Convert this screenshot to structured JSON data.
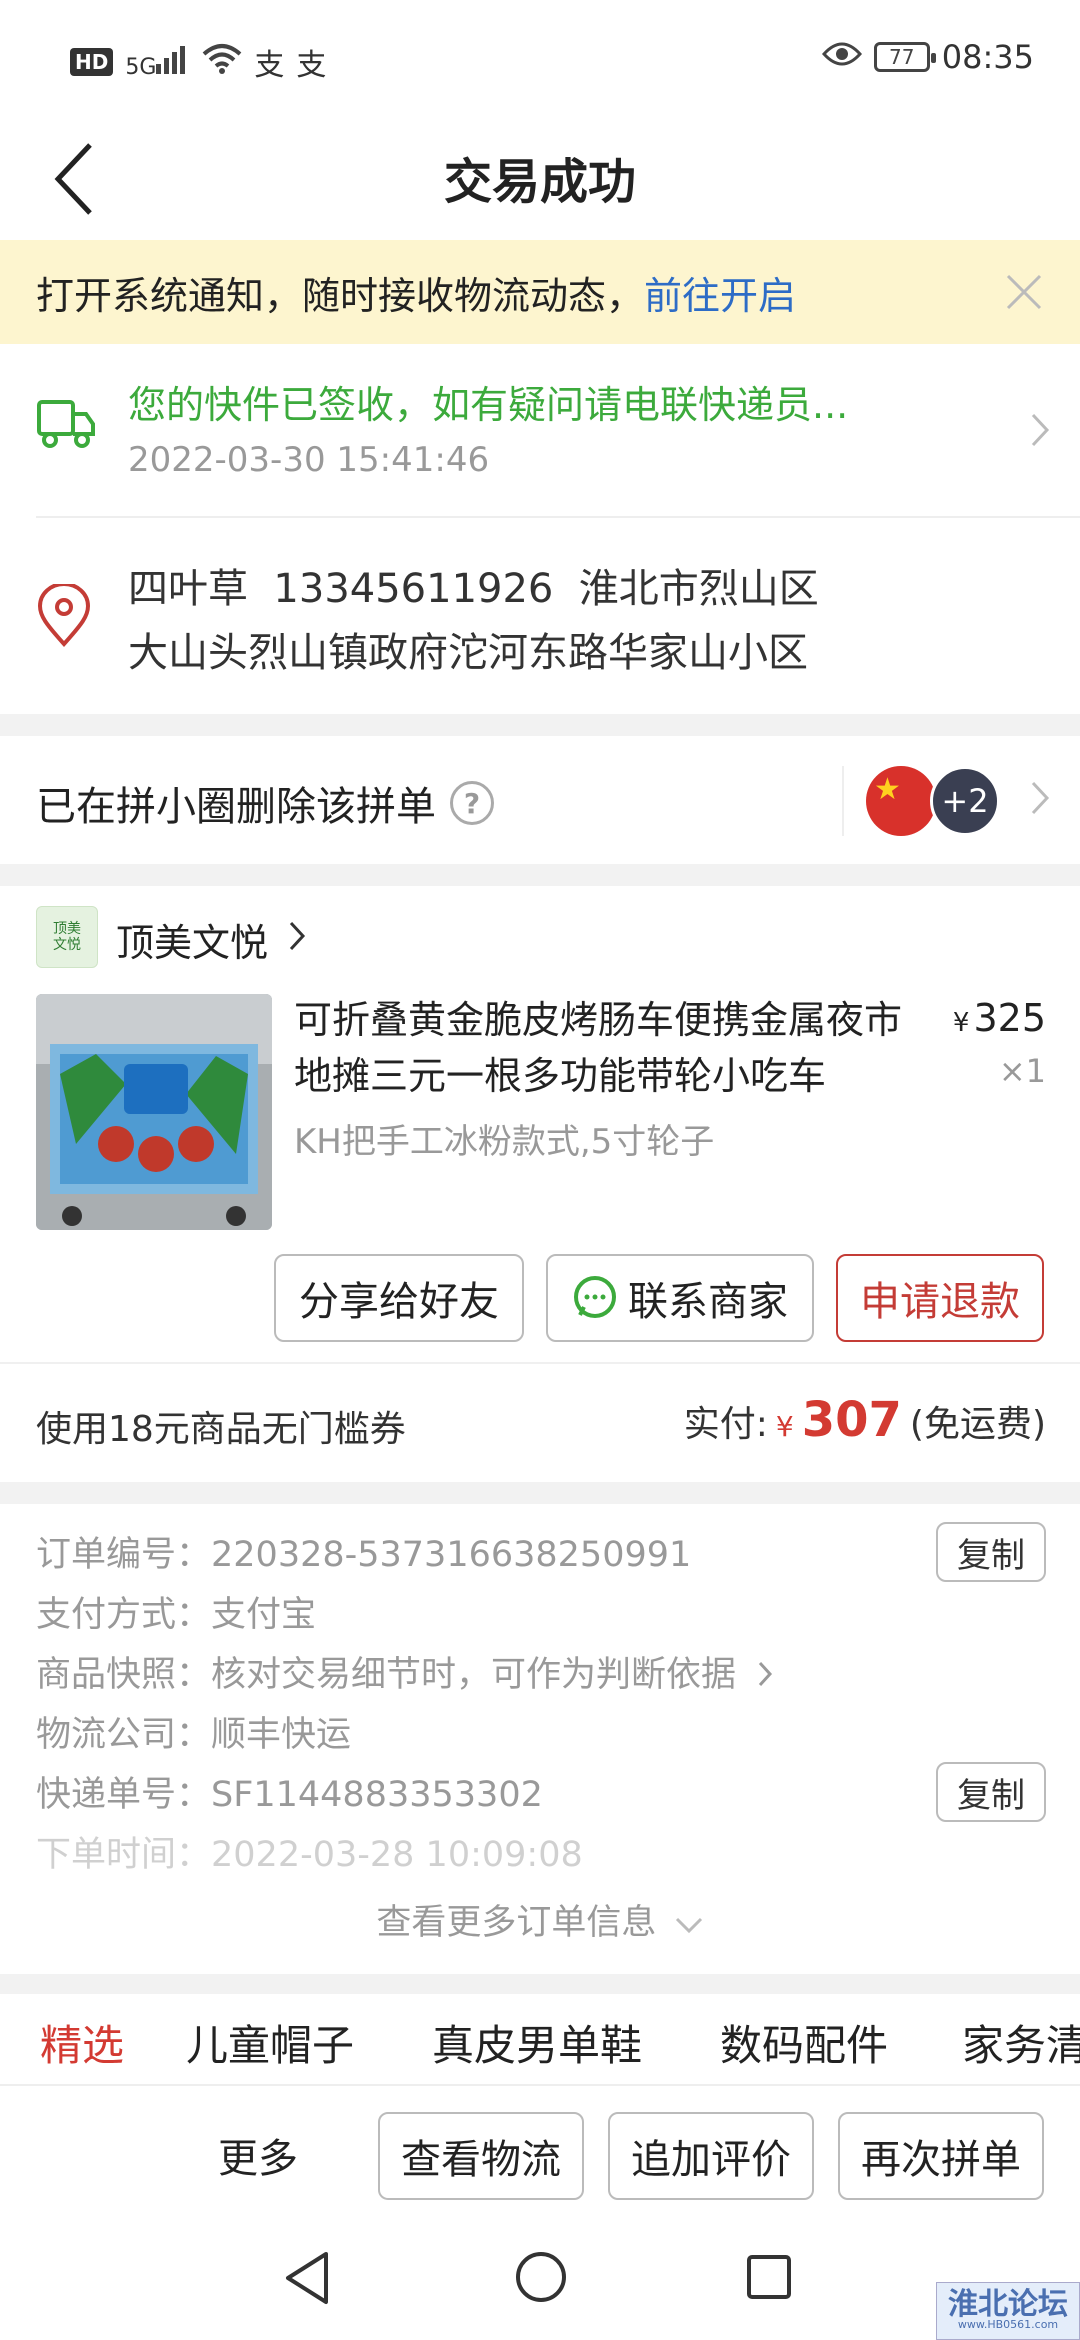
{
  "status_bar": {
    "hd": "HD",
    "net": "5G",
    "battery": "77",
    "time": "08:35"
  },
  "header": {
    "title": "交易成功"
  },
  "notice": {
    "text": "打开系统通知，随时接收物流动态，",
    "link": "前往开启"
  },
  "delivery": {
    "message": "您的快件已签收，如有疑问请电联快递员...",
    "time": "2022-03-30 15:41:46"
  },
  "address": {
    "line1": "四叶草  13345611926  淮北市烈山区",
    "line2": "大山头烈山镇政府沱河东路华家山小区"
  },
  "group": {
    "label": "已在拼小圈删除该拼单",
    "help": "?",
    "avatar_more": "+2"
  },
  "shop": {
    "logo_text": "顶美\n文悦",
    "name": "顶美文悦"
  },
  "product": {
    "title": "可折叠黄金脆皮烤肠车便携金属夜市地摊三元一根多功能带轮小吃车",
    "price_symbol": "¥",
    "price": "325",
    "qty": "×1",
    "spec": "KH把手工冰粉款式,5寸轮子"
  },
  "product_buttons": {
    "share": "分享给好友",
    "contact": "联系商家",
    "refund": "申请退款"
  },
  "payment": {
    "coupon": "使用18元商品无门槛券",
    "paid_label": "实付:",
    "symbol": "¥",
    "amount": "307",
    "shipping": "(免运费)"
  },
  "order_info": {
    "rows": [
      {
        "label": "订单编号：",
        "value": "220328-537316638250991"
      },
      {
        "label": "支付方式：",
        "value": "支付宝"
      },
      {
        "label": "商品快照：",
        "value": "核对交易细节时，可作为判断依据"
      },
      {
        "label": "物流公司：",
        "value": "顺丰快运"
      },
      {
        "label": "快递单号：",
        "value": "SF1144883353302"
      },
      {
        "label": "下单时间：",
        "value": "2022-03-28 10:09:08"
      }
    ],
    "copy": "复制",
    "more": "查看更多订单信息"
  },
  "tabs": [
    "精选",
    "儿童帽子",
    "真皮男单鞋",
    "数码配件",
    "家务清"
  ],
  "actions": {
    "more": "更多",
    "logistics": "查看物流",
    "review": "追加评价",
    "rebuy": "再次拼单"
  },
  "watermark": {
    "text": "淮北论坛",
    "url": "www.HB0561.com"
  },
  "colors": {
    "accent_red": "#d33a32",
    "success_green": "#3caa3c",
    "link_blue": "#2d6cc6",
    "notice_bg": "#fdf5cf"
  }
}
